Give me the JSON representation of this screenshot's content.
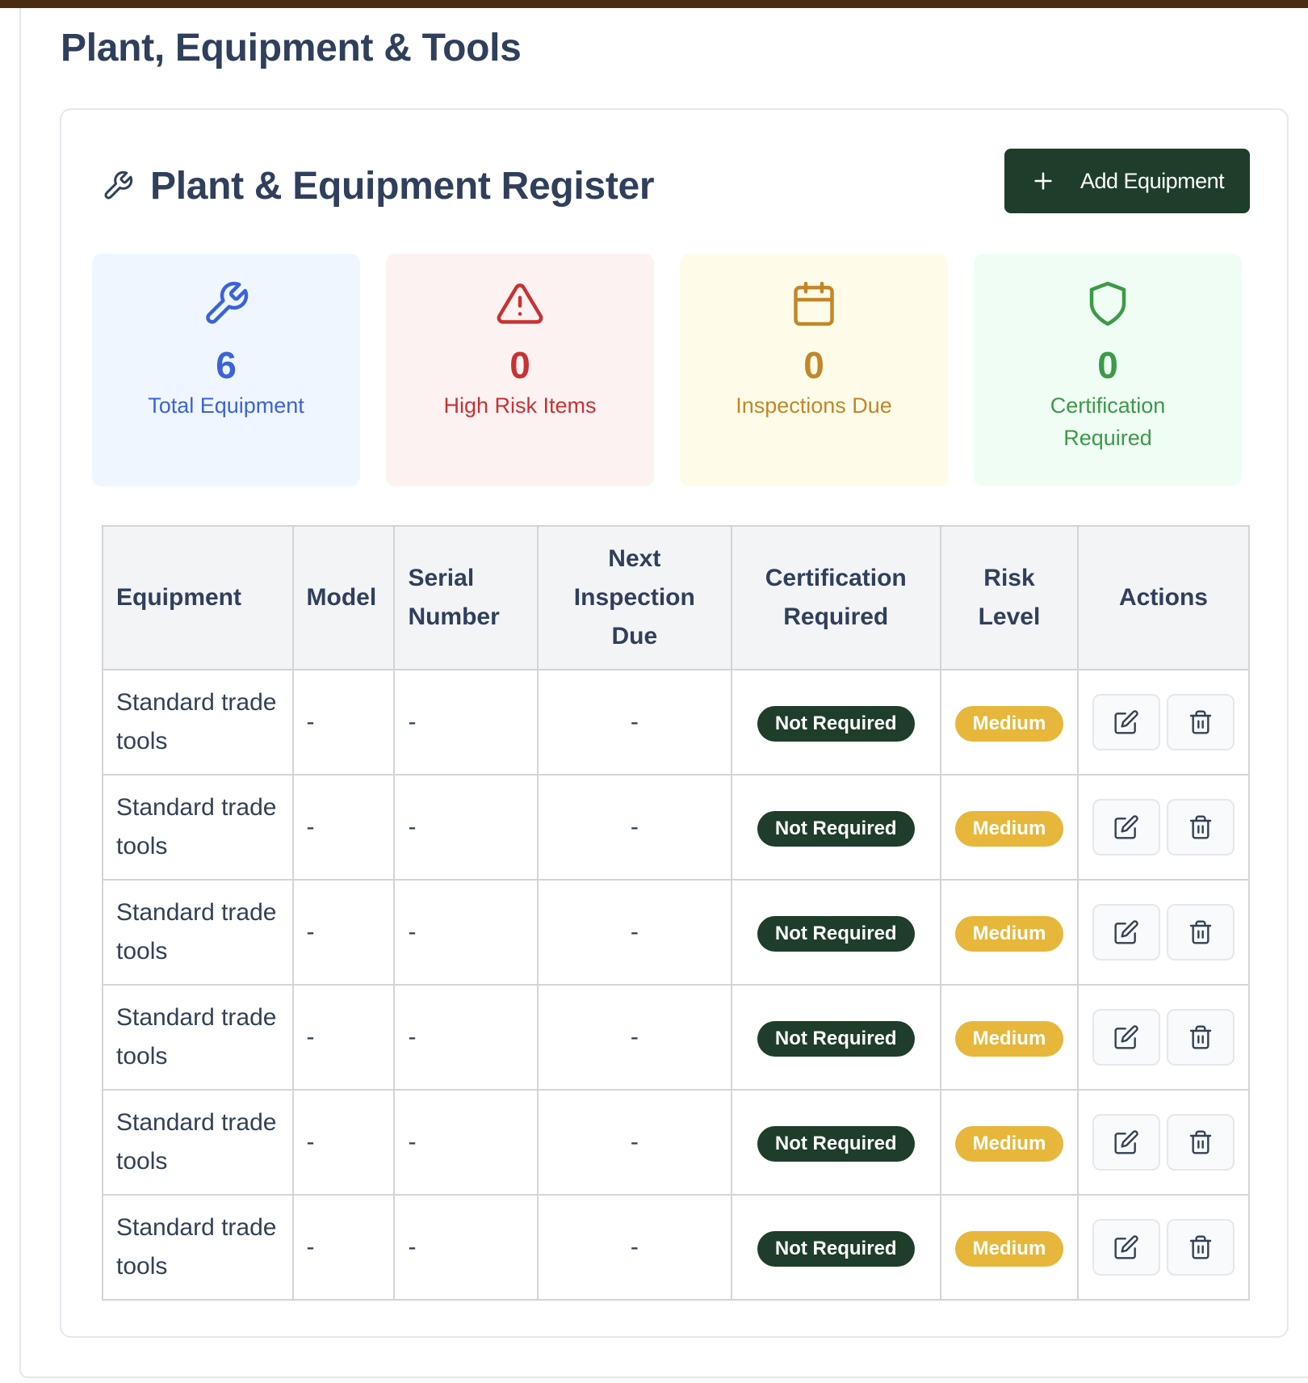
{
  "page": {
    "title": "Plant, Equipment & Tools"
  },
  "register": {
    "title": "Plant & Equipment Register",
    "add_label": "Add Equipment",
    "title_icon": "wrench-icon",
    "add_icon": "plus-icon"
  },
  "stats": [
    {
      "icon": "wrench-icon",
      "value": "6",
      "label": "Total Equipment",
      "color": "#3b63d9",
      "bg": "#eff6ff"
    },
    {
      "icon": "warning-triangle-icon",
      "value": "0",
      "label": "High Risk Items",
      "color": "#c83232",
      "bg": "#fdf2f2"
    },
    {
      "icon": "calendar-icon",
      "value": "0",
      "label": "Inspections Due",
      "color": "#c4862a",
      "bg": "#fefce8"
    },
    {
      "icon": "shield-icon",
      "value": "0",
      "label": "Certification Required",
      "color": "#3c9a48",
      "bg": "#f0fdf4"
    }
  ],
  "table": {
    "headers": [
      "Equipment",
      "Model",
      "Serial Number",
      "Next Inspection Due",
      "Certification Required",
      "Risk Level",
      "Actions"
    ],
    "rows": [
      {
        "equipment": "Standard trade tools",
        "model": "-",
        "serial": "-",
        "next_inspection": "-",
        "certification": "Not Required",
        "risk": "Medium"
      },
      {
        "equipment": "Standard trade tools",
        "model": "-",
        "serial": "-",
        "next_inspection": "-",
        "certification": "Not Required",
        "risk": "Medium"
      },
      {
        "equipment": "Standard trade tools",
        "model": "-",
        "serial": "-",
        "next_inspection": "-",
        "certification": "Not Required",
        "risk": "Medium"
      },
      {
        "equipment": "Standard trade tools",
        "model": "-",
        "serial": "-",
        "next_inspection": "-",
        "certification": "Not Required",
        "risk": "Medium"
      },
      {
        "equipment": "Standard trade tools",
        "model": "-",
        "serial": "-",
        "next_inspection": "-",
        "certification": "Not Required",
        "risk": "Medium"
      },
      {
        "equipment": "Standard trade tools",
        "model": "-",
        "serial": "-",
        "next_inspection": "-",
        "certification": "Not Required",
        "risk": "Medium"
      }
    ],
    "action_icons": [
      "edit-icon",
      "trash-icon"
    ]
  },
  "colors": {
    "brand_dark_green": "#1e3d2a",
    "risk_medium": "#e7b73b",
    "heading": "#2f3f5c"
  }
}
